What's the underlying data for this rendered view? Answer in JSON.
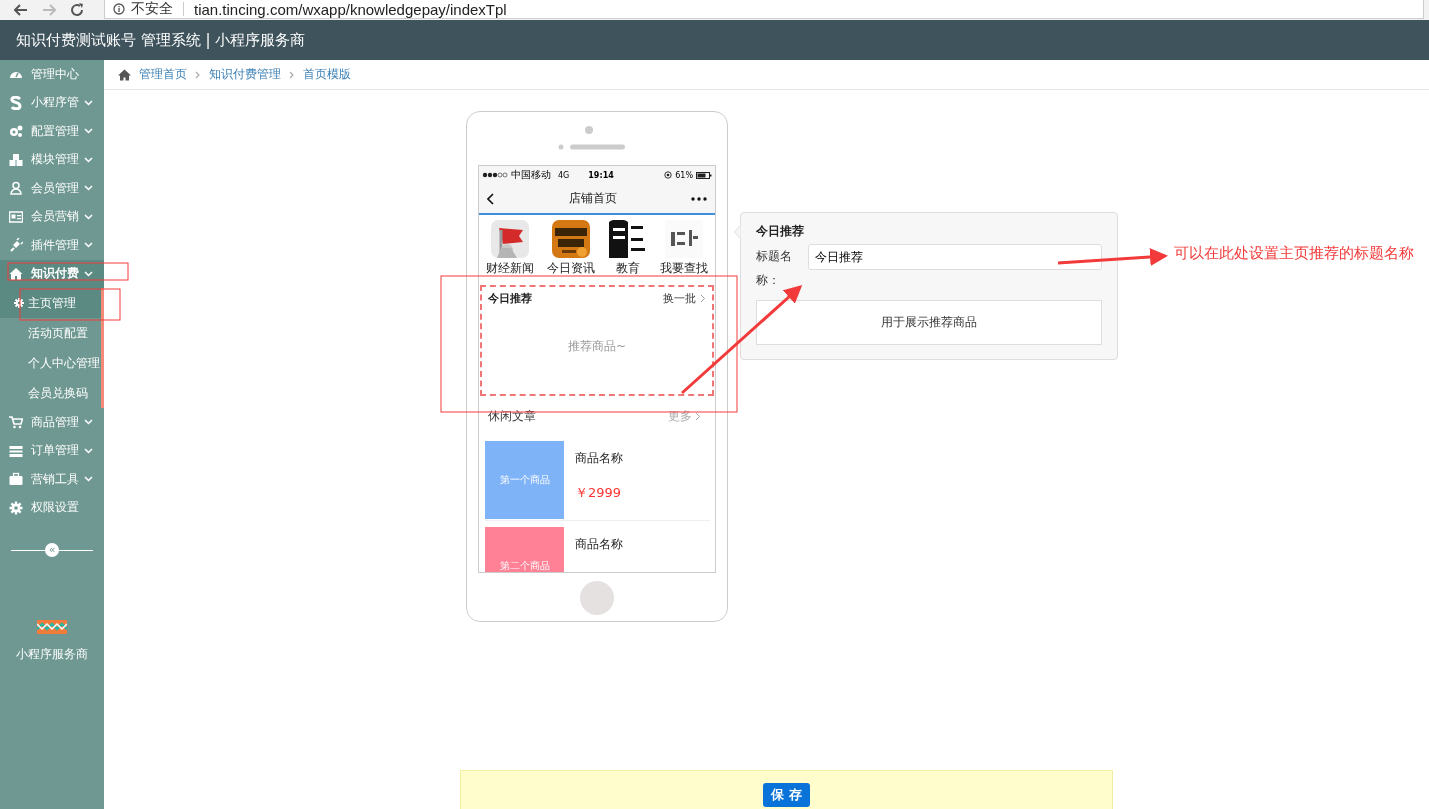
{
  "browser": {
    "security_label": "不安全",
    "url": "tian.tincing.com/wxapp/knowledgepay/indexTpl"
  },
  "header": {
    "title": "知识付费测试账号 管理系统 | 小程序服务商"
  },
  "sidebar": {
    "items": [
      {
        "label": "管理中心",
        "kind": "link"
      },
      {
        "label": "小程序管",
        "kind": "menu",
        "expanded": false
      },
      {
        "label": "配置管理",
        "kind": "menu",
        "expanded": false
      },
      {
        "label": "模块管理",
        "kind": "menu",
        "expanded": false
      },
      {
        "label": "会员管理",
        "kind": "menu",
        "expanded": false
      },
      {
        "label": "会员营销",
        "kind": "menu",
        "expanded": false
      },
      {
        "label": "插件管理",
        "kind": "menu",
        "expanded": false
      },
      {
        "label": "知识付费",
        "kind": "menu",
        "expanded": true,
        "children": [
          {
            "label": "主页管理",
            "selected": true
          },
          {
            "label": "活动页配置",
            "selected": false
          },
          {
            "label": "个人中心管理",
            "selected": false
          },
          {
            "label": "会员兑换码",
            "selected": false
          }
        ]
      },
      {
        "label": "商品管理",
        "kind": "menu",
        "expanded": false
      },
      {
        "label": "订单管理",
        "kind": "menu",
        "expanded": false
      },
      {
        "label": "营销工具",
        "kind": "menu",
        "expanded": false
      },
      {
        "label": "权限设置",
        "kind": "link"
      }
    ],
    "collapse_glyph": "«",
    "brand": "小程序服务商"
  },
  "breadcrumb": [
    "管理首页",
    "知识付费管理",
    "首页模版"
  ],
  "phone": {
    "status_bar": {
      "carrier": "中国移动",
      "network": "4G",
      "time": "19:14",
      "battery": "61%"
    },
    "nav_title": "店铺首页",
    "shortcuts": [
      {
        "label": "财经新闻",
        "kind": "picture"
      },
      {
        "label": "今日资讯",
        "kind": "picture"
      },
      {
        "label": "教育",
        "kind": "picture"
      },
      {
        "label": "我要查找",
        "kind": "picture"
      }
    ],
    "recommend": {
      "title": "今日推荐",
      "action": "换一批",
      "placeholder": "推荐商品~",
      "selected": true
    },
    "articles": {
      "title": "休闲文章",
      "more": "更多"
    },
    "products": [
      {
        "thumb_label": "第一个商品",
        "color": "#7fb3f8",
        "name": "商品名称",
        "price": "￥2999"
      },
      {
        "thumb_label": "第二个商品",
        "color": "#ff8196",
        "name": "商品名称"
      }
    ]
  },
  "editor": {
    "title": "今日推荐",
    "field_label": "标题名称：",
    "field_value": "今日推荐",
    "description": "用于展示推荐商品"
  },
  "annotation": {
    "note": "可以在此处设置主页推荐的标题名称"
  },
  "save_button": "保 存"
}
